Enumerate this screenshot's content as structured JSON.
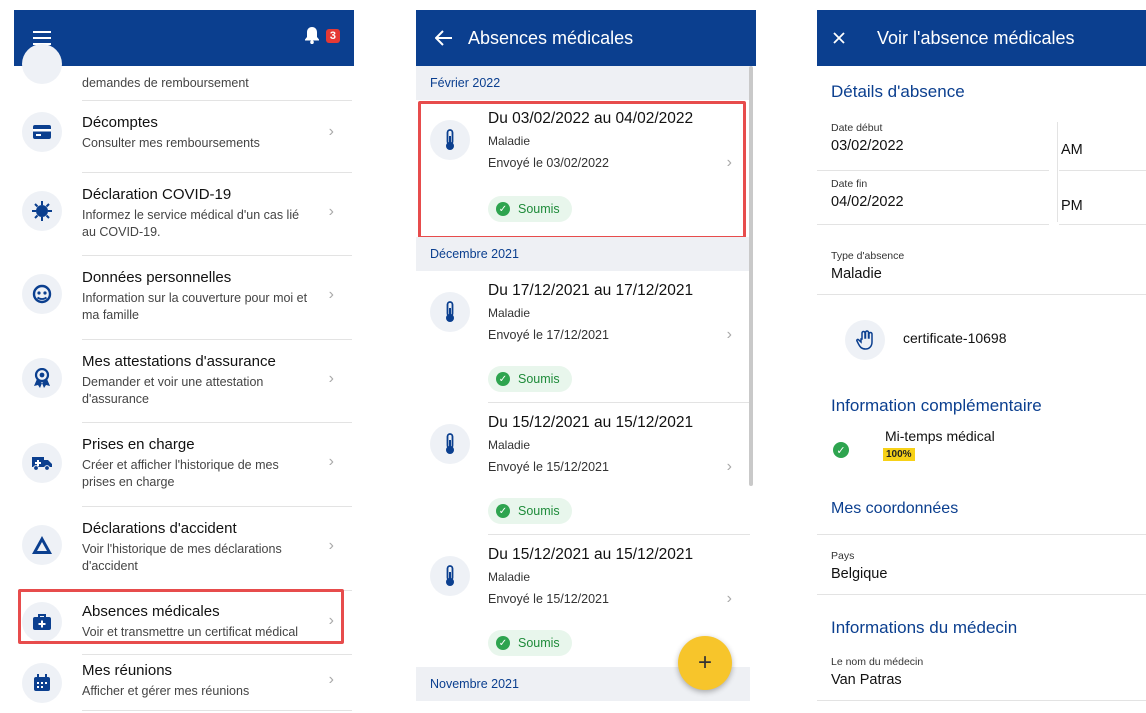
{
  "panel1": {
    "badge_count": "3",
    "items": [
      {
        "title": "",
        "sub": "demandes de remboursement"
      },
      {
        "title": "Décomptes",
        "sub": "Consulter mes remboursements"
      },
      {
        "title": "Déclaration COVID-19",
        "sub": "Informez le service médical d'un cas lié au COVID-19."
      },
      {
        "title": "Données personnelles",
        "sub": "Information sur la couverture pour moi et ma famille"
      },
      {
        "title": "Mes attestations d'assurance",
        "sub": "Demander et voir une attestation d'assurance"
      },
      {
        "title": "Prises en charge",
        "sub": "Créer et afficher l'historique de mes prises en charge"
      },
      {
        "title": "Déclarations d'accident",
        "sub": "Voir l'historique de mes déclarations d'accident"
      },
      {
        "title": "Absences médicales",
        "sub": "Voir et transmettre un certificat médical"
      },
      {
        "title": "Mes réunions",
        "sub": "Afficher et gérer mes réunions"
      }
    ]
  },
  "panel2": {
    "title": "Absences médicales",
    "sections": [
      "Février 2022",
      "Décembre 2021",
      "Novembre 2021"
    ],
    "cards": [
      {
        "title": "Du 03/02/2022 au 04/02/2022",
        "type": "Maladie",
        "sent": "Envoyé le 03/02/2022",
        "status": "Soumis"
      },
      {
        "title": "Du 17/12/2021 au 17/12/2021",
        "type": "Maladie",
        "sent": "Envoyé le 17/12/2021",
        "status": "Soumis"
      },
      {
        "title": "Du 15/12/2021 au 15/12/2021",
        "type": "Maladie",
        "sent": "Envoyé le 15/12/2021",
        "status": "Soumis"
      },
      {
        "title": "Du 15/12/2021 au 15/12/2021",
        "type": "Maladie",
        "sent": "Envoyé le 15/12/2021",
        "status": "Soumis"
      }
    ],
    "fab_label": "+"
  },
  "panel3": {
    "title": "Voir l'absence médicales",
    "details_title": "Détails d'absence",
    "start_label": "Date début",
    "start_value": "03/02/2022",
    "start_half": "AM",
    "end_label": "Date fin",
    "end_value": "04/02/2022",
    "end_half": "PM",
    "type_label": "Type d'absence",
    "type_value": "Maladie",
    "certificate": "certificate-10698",
    "info_title": "Information complémentaire",
    "info_value": "Mi-temps médical",
    "info_tag": "100%",
    "coords_title": "Mes coordonnées",
    "country_label": "Pays",
    "country_value": "Belgique",
    "doctor_title": "Informations du médecin",
    "doctor_label": "Le nom du médecin",
    "doctor_value": "Van Patras"
  },
  "colors": {
    "brand": "#0b3f8f",
    "accent": "#f7c52b",
    "highlight": "#e74c4c",
    "success": "#2ea44f"
  }
}
